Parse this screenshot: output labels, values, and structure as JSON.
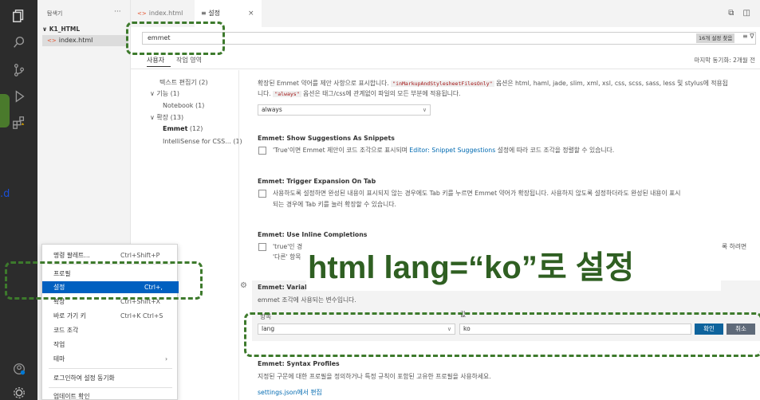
{
  "explorer": {
    "title": "탐색기",
    "more": "···",
    "folder": "K1_HTML",
    "file": "index.html",
    "file_icon": "<>"
  },
  "tabs": [
    {
      "label": "index.html",
      "icon": "<>"
    },
    {
      "label": "설정",
      "icon": "≡"
    }
  ],
  "tab_close": "×",
  "tab_actions": "⧉ ◫",
  "search": {
    "value": "emmet",
    "count": "16개 설정 찾음",
    "tools": "≡ ∇"
  },
  "scope": {
    "user": "사용자",
    "workspace": "작업 영역",
    "last_sync": "마지막 동기화: 2개월 전"
  },
  "toc": [
    {
      "label": "텍스트 편집기 (2)"
    },
    {
      "label": "∨ 기능 (1)"
    },
    {
      "label": "Notebook (1)"
    },
    {
      "label": "∨ 확장 (13)"
    },
    {
      "label": "Emmet",
      "count": " (12)"
    },
    {
      "label": "IntelliSense for CSS... (1)"
    }
  ],
  "settings": {
    "top_desc_1a": "확장된 Emmet 약어를 제안 사항으로 표시합니다. ",
    "top_desc_1_code": "\"inMarkupAndStylesheetFilesOnly\"",
    "top_desc_1b": " 옵션은 html, haml, jade, slim, xml, xsl, css, scss, sass, less 및 stylus에 적용됩",
    "top_desc_2a": "니다. ",
    "top_desc_2_code": "\"always\"",
    "top_desc_2b": " 옵션은 태그/css에 관계없이 파일의 모든 부분에 적용됩니다.",
    "top_select": "always",
    "s1_title": "Emmet: Show Suggestions As Snippets",
    "s1_desc_a": "'True'이면 Emmet 제안이 코드 조각으로 표시되며 ",
    "s1_link": "Editor: Snippet Suggestions",
    "s1_desc_b": " 설정에 따라 코드 조각을 정렬할 수 있습니다.",
    "s2_title": "Emmet: Trigger Expansion On Tab",
    "s2_desc_1": "사용하도록 설정하면 완성된 내용이 표시되지 않는 경우에도 Tab 키를 누르면 Emmet 약어가 확장됩니다. 사용하지 않도록 설정하더라도 완성된 내용이 표시",
    "s2_desc_2": "되는 경우에 Tab 키를 눌러 확장할 수 있습니다.",
    "s3_title": "Emmet: Use Inline Completions",
    "s3_desc_1": "'true'인 경",
    "s3_desc_2": "'다른' 항목",
    "s3_desc_right": "록 하려면",
    "s4_title": "Emmet: Variabl",
    "s4_desc": "emmet 조각에 사용되는 변수입니다.",
    "col_item": "항목",
    "col_value": "값",
    "key_value": "lang",
    "val_value": "ko",
    "ok": "확인",
    "cancel": "취소",
    "s5_title": "Emmet: Syntax Profiles",
    "s5_desc": "지정된 구문에 대한 프로필을 정의하거나 특정 규칙이 포함된 고유한 프로필을 사용하세요.",
    "s5_link": "settings.json에서 편집"
  },
  "menu": [
    {
      "label": "명령 팔레트...",
      "key": "Ctrl+Shift+P"
    },
    {
      "label": "프로필",
      "key": ""
    },
    {
      "label": "설정",
      "key": "Ctrl+,"
    },
    {
      "label": "확장",
      "key": "Ctrl+Shift+X"
    },
    {
      "label": "바로 가기 키",
      "key": "Ctrl+K Ctrl+S"
    },
    {
      "label": "코드 조각",
      "key": ""
    },
    {
      "label": "작업",
      "key": ""
    },
    {
      "label": "테마",
      "key": "",
      "arrow": "›"
    },
    {
      "label": "로그인하여 설정 동기화",
      "key": ""
    },
    {
      "label": "업데이트 확인",
      "key": ""
    }
  ],
  "overlay": {
    "callout": "html lang=“ko”로 설정",
    "edge_text": ".d"
  },
  "colors": {
    "accent": "#0060c0",
    "annotation_green": "#3d7a2c",
    "callout_text": "#2f5f22"
  }
}
